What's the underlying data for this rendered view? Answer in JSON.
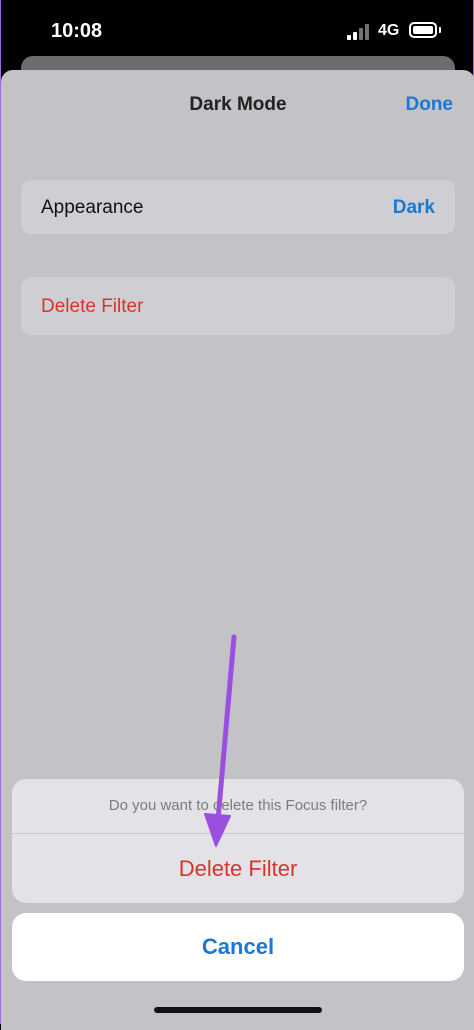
{
  "status_bar": {
    "time": "10:08",
    "network": "4G",
    "icons": [
      "signal-icon",
      "battery-icon"
    ]
  },
  "nav": {
    "title": "Dark Mode",
    "done_label": "Done"
  },
  "settings": {
    "appearance_label": "Appearance",
    "appearance_value": "Dark",
    "delete_filter_label": "Delete Filter"
  },
  "action_sheet": {
    "message": "Do you want to delete this Focus filter?",
    "delete_label": "Delete Filter",
    "cancel_label": "Cancel"
  },
  "colors": {
    "accent": "#1b78d4",
    "destructive": "#d9342b",
    "annotation": "#9b4fe0"
  }
}
